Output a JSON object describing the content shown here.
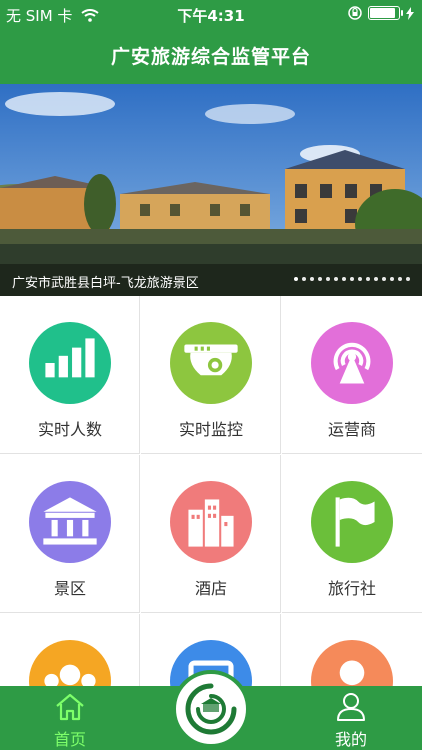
{
  "status_bar": {
    "carrier": "无 SIM 卡",
    "time": "下午4:31",
    "battery_level": 0.95
  },
  "header": {
    "title": "广安旅游综合监管平台"
  },
  "banner": {
    "caption": "广安市武胜县白坪-飞龙旅游景区",
    "page_count": 15,
    "active_index": 0
  },
  "grid": {
    "items": [
      {
        "label": "实时人数",
        "icon": "signal-bars-icon",
        "color": "#20c08b"
      },
      {
        "label": "实时监控",
        "icon": "security-camera-icon",
        "color": "#8dc63f"
      },
      {
        "label": "运营商",
        "icon": "broadcast-antenna-icon",
        "color": "#e26fd9"
      },
      {
        "label": "景区",
        "icon": "museum-icon",
        "color": "#8c7ce8"
      },
      {
        "label": "酒店",
        "icon": "buildings-icon",
        "color": "#f07b7b"
      },
      {
        "label": "旅行社",
        "icon": "flag-icon",
        "color": "#6bbf3a"
      },
      {
        "label": "",
        "icon": "group-icon",
        "color": "#f5a623"
      },
      {
        "label": "",
        "icon": "bus-icon",
        "color": "#3d8be8"
      },
      {
        "label": "",
        "icon": "person-icon",
        "color": "#f58a5a"
      }
    ]
  },
  "tab_bar": {
    "home_label": "首页",
    "mine_label": "我的",
    "home_color": "#7dff6a",
    "accent": "#2e9b45"
  }
}
